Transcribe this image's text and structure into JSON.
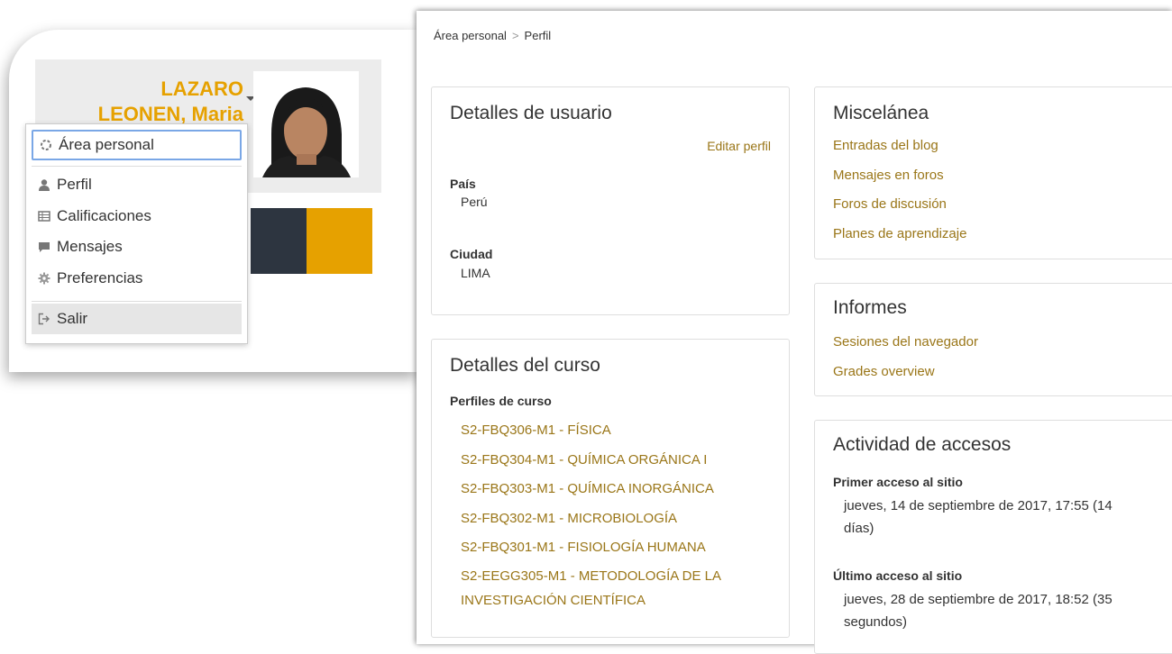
{
  "user": {
    "name_line1": "LAZARO",
    "name_line2": "LEONEN, Maria"
  },
  "usermenu": {
    "items": [
      {
        "label": "Área personal",
        "icon": "dashboard-icon"
      },
      {
        "label": "Perfil",
        "icon": "user-icon"
      },
      {
        "label": "Calificaciones",
        "icon": "grades-table-icon"
      },
      {
        "label": "Mensajes",
        "icon": "message-bubble-icon"
      },
      {
        "label": "Preferencias",
        "icon": "gear-icon"
      },
      {
        "label": "Salir",
        "icon": "logout-icon"
      }
    ]
  },
  "breadcrumb": {
    "home": "Área personal",
    "current": "Perfil"
  },
  "user_details": {
    "title": "Detalles de usuario",
    "edit_link": "Editar perfil",
    "country_label": "País",
    "country_value": "Perú",
    "city_label": "Ciudad",
    "city_value": "LIMA"
  },
  "course_details": {
    "title": "Detalles del curso",
    "profiles_label": "Perfiles de curso",
    "courses": [
      "S2-FBQ306-M1 - FÍSICA",
      "S2-FBQ304-M1 - QUÍMICA ORGÁNICA I",
      "S2-FBQ303-M1 - QUÍMICA INORGÁNICA",
      "S2-FBQ302-M1 - MICROBIOLOGÍA",
      "S2-FBQ301-M1 - FISIOLOGÍA HUMANA",
      "S2-EEGG305-M1 - METODOLOGÍA DE LA",
      "INVESTIGACIÓN CIENTÍFICA"
    ]
  },
  "misc": {
    "title": "Miscelánea",
    "links": [
      "Entradas del blog",
      "Mensajes en foros",
      "Foros de discusión",
      "Planes de aprendizaje"
    ]
  },
  "reports": {
    "title": "Informes",
    "links": [
      "Sesiones del navegador",
      "Grades overview"
    ]
  },
  "access": {
    "title": "Actividad de accesos",
    "first_label": "Primer acceso al sitio",
    "first_value_line1": "jueves, 14 de septiembre de 2017, 17:55  (14",
    "first_value_line2": "días)",
    "last_label": "Último acceso al sitio",
    "last_value_line1": "jueves, 28 de septiembre de 2017, 18:52  (35",
    "last_value_line2": "segundos)"
  },
  "colors": {
    "accent_gold": "#e6a100",
    "link": "#9a7618",
    "dark_tile": "#2d3540"
  }
}
